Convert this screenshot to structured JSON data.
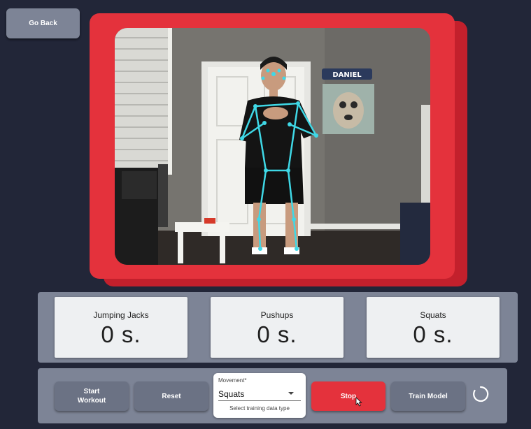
{
  "nav": {
    "go_back_label": "Go Back"
  },
  "video": {
    "wall_text": "DANIEL",
    "pose_overlay_color": "#3fd8e6",
    "frame_color": "#e4323c"
  },
  "stats": [
    {
      "label": "Jumping Jacks",
      "value": "0 s."
    },
    {
      "label": "Pushups",
      "value": "0 s."
    },
    {
      "label": "Squats",
      "value": "0 s."
    }
  ],
  "controls": {
    "start_label_line1": "Start",
    "start_label_line2": "Workout",
    "reset_label": "Reset",
    "movement_label": "Movement",
    "movement_required_marker": "*",
    "movement_value": "Squats",
    "movement_helper": "Select training data type",
    "stop_label": "Stop",
    "train_label": "Train Model",
    "spinner_icon": "loading-spinner-icon"
  },
  "colors": {
    "background": "#222638",
    "panel": "#7d8496",
    "button": "#6b7284",
    "accent_red": "#e4323c"
  }
}
